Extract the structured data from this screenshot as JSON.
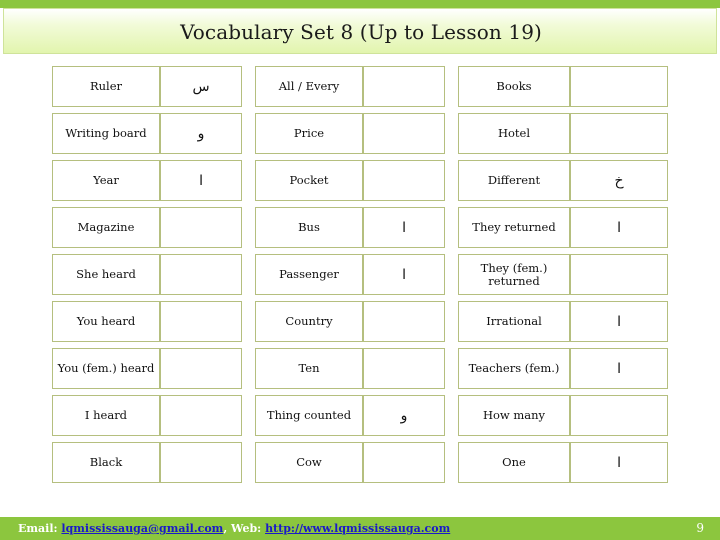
{
  "slide": {
    "title": "Vocabulary Set 8 (Up to Lesson 19)",
    "header_strip_color": "#8CC63E",
    "footer_bar_color": "#8CC63E",
    "cell_border_color": "#b5bf7f"
  },
  "footer": {
    "email_label": "Email:",
    "email_value": "lqmississauga@gmail.com",
    "separator": ", ",
    "web_label": "Web:",
    "web_value": "http://www.lqmississauga.com",
    "page_number": "9"
  },
  "columns": [
    {
      "name": "column-1",
      "rows": [
        {
          "term": "Ruler",
          "arabic": "س"
        },
        {
          "term": "Writing board",
          "arabic": "و"
        },
        {
          "term": "Year",
          "arabic": "ا"
        },
        {
          "term": "Magazine",
          "arabic": ""
        },
        {
          "term": "She heard",
          "arabic": ""
        },
        {
          "term": "You heard",
          "arabic": ""
        },
        {
          "term": "You (fem.) heard",
          "arabic": ""
        },
        {
          "term": "I heard",
          "arabic": ""
        },
        {
          "term": "Black",
          "arabic": ""
        }
      ]
    },
    {
      "name": "column-2",
      "rows": [
        {
          "term": "All / Every",
          "arabic": ""
        },
        {
          "term": "Price",
          "arabic": ""
        },
        {
          "term": "Pocket",
          "arabic": ""
        },
        {
          "term": "Bus",
          "arabic": "ا"
        },
        {
          "term": "Passenger",
          "arabic": "ا"
        },
        {
          "term": "Country",
          "arabic": ""
        },
        {
          "term": "Ten",
          "arabic": ""
        },
        {
          "term": "Thing counted",
          "arabic": "و"
        },
        {
          "term": "Cow",
          "arabic": ""
        }
      ]
    },
    {
      "name": "column-3",
      "rows": [
        {
          "term": "Books",
          "arabic": ""
        },
        {
          "term": "Hotel",
          "arabic": ""
        },
        {
          "term": "Different",
          "arabic": "خ"
        },
        {
          "term": "They returned",
          "arabic": "ا"
        },
        {
          "term": "They (fem.) returned",
          "arabic": ""
        },
        {
          "term": "Irrational",
          "arabic": "ا"
        },
        {
          "term": "Teachers (fem.)",
          "arabic": "ا"
        },
        {
          "term": "How many",
          "arabic": ""
        },
        {
          "term": "One",
          "arabic": "ا"
        }
      ]
    }
  ]
}
